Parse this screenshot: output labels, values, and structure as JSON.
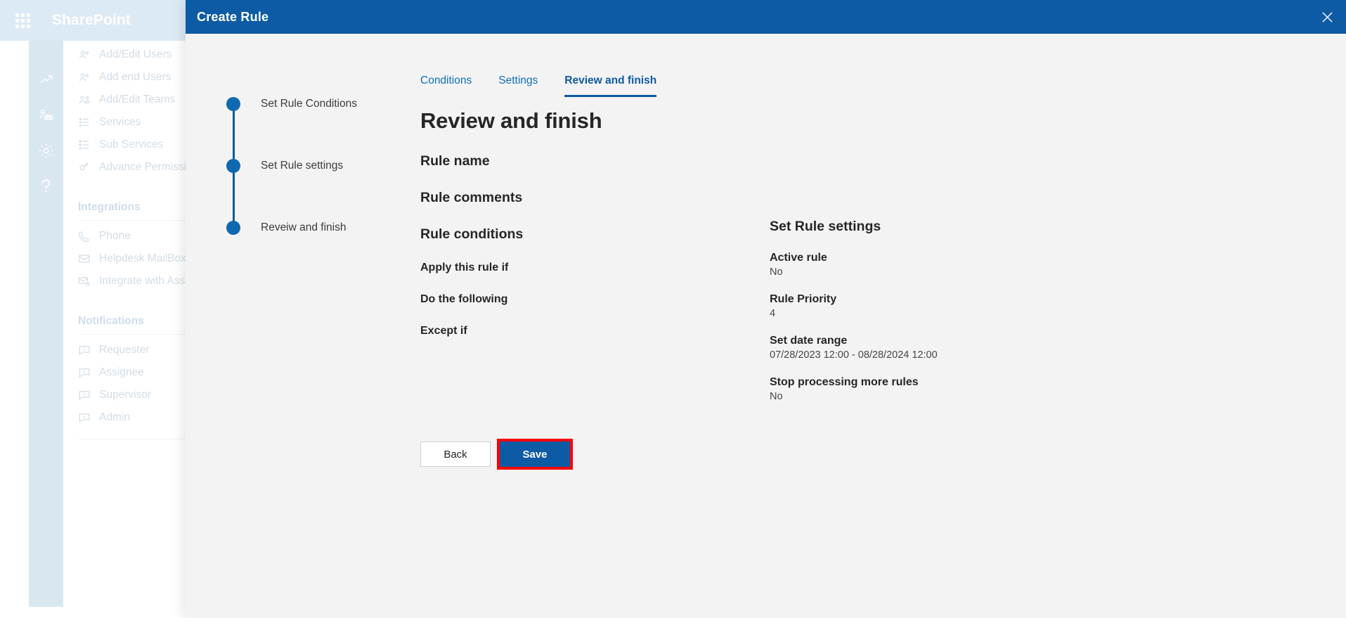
{
  "suite": {
    "app_name": "SharePoint",
    "waffle_icon": "waffle-grid-icon"
  },
  "rail": {
    "items": [
      {
        "icon": "analytics-chart-icon",
        "active": false
      },
      {
        "icon": "people-team-icon",
        "active": false
      },
      {
        "icon": "gear-settings-icon",
        "active": true
      },
      {
        "icon": "help-question-icon",
        "active": false
      }
    ]
  },
  "nav": {
    "items_top": [
      {
        "label": "Add/Edit Users",
        "icon": "users-icon"
      },
      {
        "label": "Add end Users",
        "icon": "users-icon"
      },
      {
        "label": "Add/Edit Teams",
        "icon": "team-icon"
      },
      {
        "label": "Services",
        "icon": "list-icon"
      },
      {
        "label": "Sub Services",
        "icon": "sublist-icon"
      },
      {
        "label": "Advance Permission",
        "icon": "key-icon"
      }
    ],
    "section_integrations": "Integrations",
    "items_integrations": [
      {
        "label": "Phone",
        "icon": "phone-icon"
      },
      {
        "label": "Helpdesk MailBox",
        "icon": "mail-icon"
      },
      {
        "label": "Integrate with Asset",
        "icon": "mail-gear-icon"
      }
    ],
    "section_notifications": "Notifications",
    "items_notifications": [
      {
        "label": "Requester",
        "icon": "comment-alert-icon"
      },
      {
        "label": "Assignee",
        "icon": "comment-alert-icon"
      },
      {
        "label": "Supervisor",
        "icon": "comment-alert-icon"
      },
      {
        "label": "Admin",
        "icon": "comment-alert-icon"
      }
    ]
  },
  "modal": {
    "title": "Create Rule",
    "close_icon": "close-x-icon",
    "steps": [
      {
        "label": "Set Rule Conditions"
      },
      {
        "label": "Set Rule settings"
      },
      {
        "label": "Reveiw and finish"
      }
    ],
    "tabs": [
      {
        "label": "Conditions",
        "active": false
      },
      {
        "label": "Settings",
        "active": false
      },
      {
        "label": "Review and finish",
        "active": true
      }
    ],
    "heading": "Review and finish",
    "left_fields": [
      {
        "label": "Rule name",
        "level": "h2"
      },
      {
        "label": "Rule comments",
        "level": "h2"
      },
      {
        "label": "Rule conditions",
        "level": "h2"
      },
      {
        "label": "Apply this rule if",
        "level": "h3"
      },
      {
        "label": "Do the following",
        "level": "h3"
      },
      {
        "label": "Except if",
        "level": "h3"
      }
    ],
    "settings_panel": {
      "title": "Set Rule settings",
      "items": [
        {
          "key": "Active rule",
          "value": "No"
        },
        {
          "key": "Rule Priority",
          "value": "4"
        },
        {
          "key": "Set date range",
          "value": "07/28/2023 12:00 - 08/28/2024 12:00"
        },
        {
          "key": "Stop processing more rules",
          "value": "No"
        }
      ]
    },
    "buttons": {
      "back": "Back",
      "save": "Save"
    }
  },
  "colors": {
    "brand_blue": "#0d5ba4",
    "tab_link": "#106ebe",
    "step_dot": "#0f69b0",
    "highlight_red": "#ff0000",
    "suite_bar": "#dceaf5",
    "rail_active": "#d9e7f1",
    "modal_bg": "#f3f3f3"
  }
}
